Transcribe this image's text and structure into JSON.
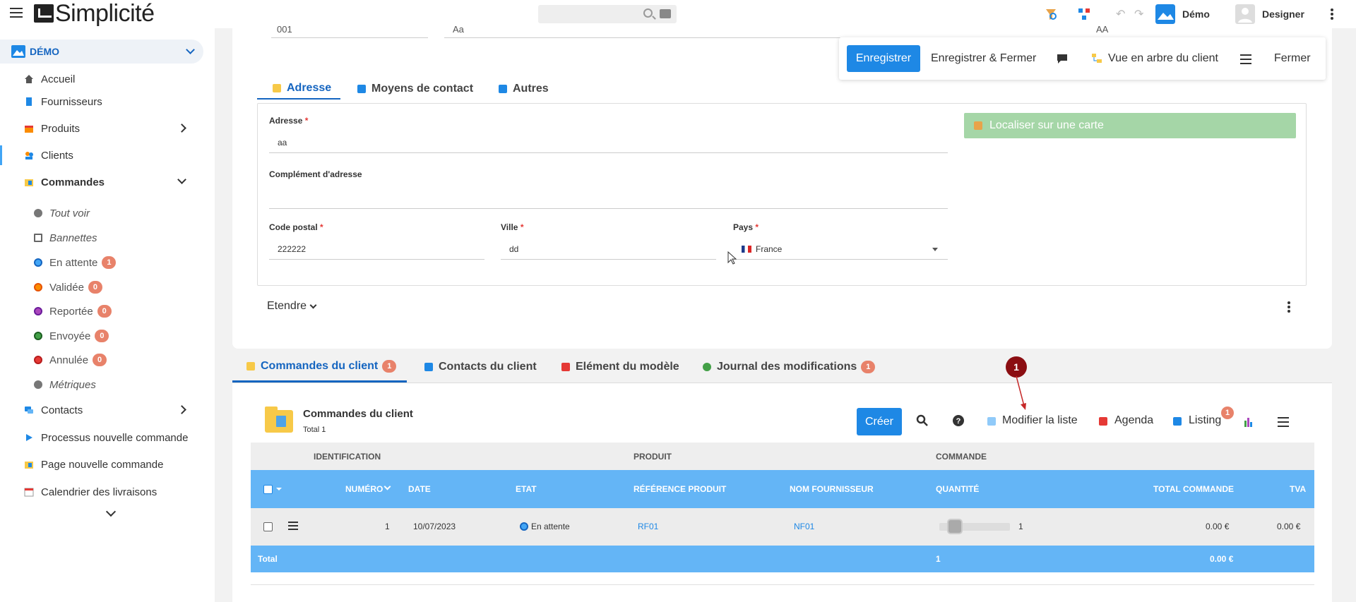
{
  "topbar": {
    "brand": "Simplicité",
    "search_placeholder": "",
    "user_scope_label": "Démo",
    "user_name": "Designer"
  },
  "sidebar": {
    "domain_label": "DÉMO",
    "items": [
      {
        "label": "Accueil"
      },
      {
        "label": "Fournisseurs"
      },
      {
        "label": "Produits"
      },
      {
        "label": "Clients"
      },
      {
        "label": "Commandes"
      }
    ],
    "commandes_sub": [
      {
        "label": "Tout voir"
      },
      {
        "label": "Bannettes"
      },
      {
        "label": "En attente",
        "badge": "1",
        "color": "#42a5f5"
      },
      {
        "label": "Validée",
        "badge": "0",
        "color": "#fb8c00"
      },
      {
        "label": "Reportée",
        "badge": "0",
        "color": "#ab47bc"
      },
      {
        "label": "Envoyée",
        "badge": "0",
        "color": "#43a047"
      },
      {
        "label": "Annulée",
        "badge": "0",
        "color": "#e53935"
      },
      {
        "label": "Métriques"
      }
    ],
    "items_after": [
      {
        "label": "Contacts"
      },
      {
        "label": "Processus nouvelle commande"
      },
      {
        "label": "Page nouvelle commande"
      },
      {
        "label": "Calendrier des livraisons"
      }
    ]
  },
  "form": {
    "cut_values": [
      "001",
      "Aa",
      "AA"
    ],
    "actions": {
      "save": "Enregistrer",
      "save_close": "Enregistrer & Fermer",
      "tree_view": "Vue en arbre du client",
      "close": "Fermer"
    },
    "tabs": [
      "Adresse",
      "Moyens de contact",
      "Autres"
    ],
    "fields": {
      "adresse_label": "Adresse",
      "adresse_value": "aa",
      "complement_label": "Complément d'adresse",
      "complement_value": "",
      "cp_label": "Code postal",
      "cp_value": "222222",
      "ville_label": "Ville",
      "ville_value": "dd",
      "pays_label": "Pays",
      "pays_value": "France",
      "required_mark": "*"
    },
    "locate_button": "Localiser sur une carte",
    "expand_label": "Etendre"
  },
  "lower": {
    "tabs": [
      {
        "label": "Commandes du client",
        "badge": "1"
      },
      {
        "label": "Contacts du client"
      },
      {
        "label": "Elément du modèle"
      },
      {
        "label": "Journal des modifications",
        "badge": "1"
      }
    ],
    "list_title": "Commandes du client",
    "list_total": "Total 1",
    "toolbar": {
      "create": "Créer",
      "edit_list": "Modifier la liste",
      "agenda": "Agenda",
      "listing": "Listing",
      "listing_badge": "1"
    },
    "groups": [
      "IDENTIFICATION",
      "PRODUIT",
      "COMMANDE"
    ],
    "columns": [
      "NUMÉRO",
      "DATE",
      "ETAT",
      "RÉFÉRENCE PRODUIT",
      "NOM FOURNISSEUR",
      "QUANTITÉ",
      "TOTAL COMMANDE",
      "TVA"
    ],
    "rows": [
      {
        "numero": "1",
        "date": "10/07/2023",
        "etat": "En attente",
        "ref": "RF01",
        "fournisseur": "NF01",
        "quantite": "1",
        "total": "0.00 €",
        "tva": "0.00 €"
      }
    ],
    "totals": {
      "label": "Total",
      "quantite": "1",
      "total": "0.00 €"
    }
  },
  "annotation": {
    "number": "1"
  }
}
